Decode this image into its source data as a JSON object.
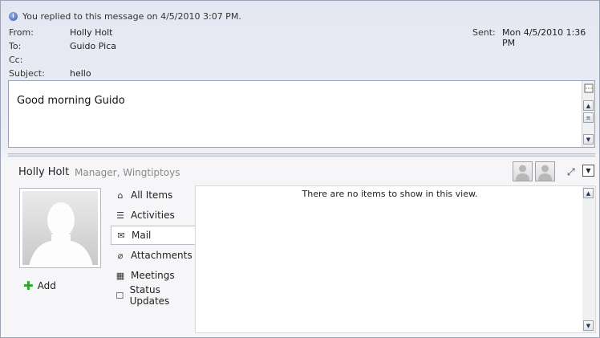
{
  "info_bar": {
    "text": "You replied to this message on 4/5/2010 3:07 PM."
  },
  "header": {
    "from_label": "From:",
    "from_value": "Holly Holt",
    "to_label": "To:",
    "to_value": "Guido Pica",
    "cc_label": "Cc:",
    "cc_value": "",
    "subject_label": "Subject:",
    "subject_value": "hello",
    "sent_label": "Sent:",
    "sent_value": "Mon 4/5/2010 1:36 PM"
  },
  "body": {
    "text": "Good morning Guido"
  },
  "people_pane": {
    "name": "Holly Holt",
    "title": "Manager, Wingtiptoys",
    "add_label": "Add",
    "nav": [
      {
        "label": "All Items",
        "icon": "home-icon"
      },
      {
        "label": "Activities",
        "icon": "activities-icon"
      },
      {
        "label": "Mail",
        "icon": "mail-icon",
        "selected": true
      },
      {
        "label": "Attachments",
        "icon": "paperclip-icon"
      },
      {
        "label": "Meetings",
        "icon": "calendar-icon"
      },
      {
        "label": "Status Updates",
        "icon": "status-icon"
      }
    ],
    "empty_message": "There are no items to show in this view."
  },
  "colors": {
    "accent": "#3a62b8",
    "add_green": "#2fa52f",
    "border": "#9aa3b6"
  }
}
